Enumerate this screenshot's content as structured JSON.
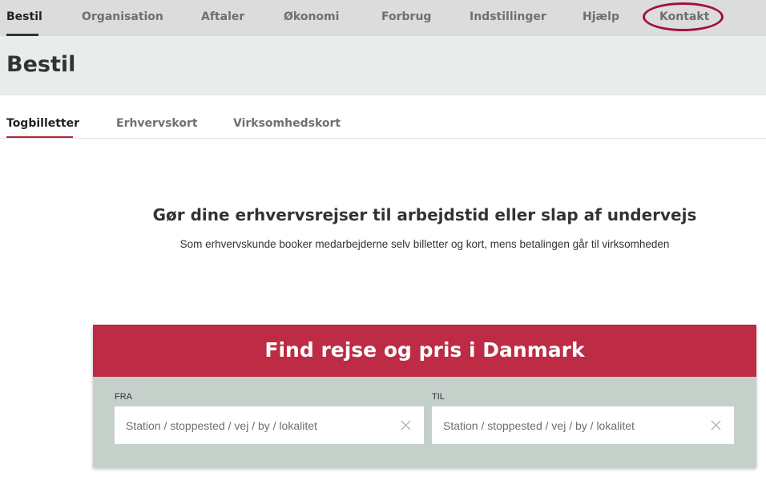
{
  "topnav": {
    "items": [
      {
        "label": "Bestil"
      },
      {
        "label": "Organisation"
      },
      {
        "label": "Aftaler"
      },
      {
        "label": "Økonomi"
      },
      {
        "label": "Forbrug"
      },
      {
        "label": "Indstillinger"
      },
      {
        "label": "Hjælp"
      },
      {
        "label": "Kontakt"
      }
    ],
    "active_index": 0
  },
  "page": {
    "title": "Bestil"
  },
  "subtabs": {
    "items": [
      {
        "label": "Togbilletter"
      },
      {
        "label": "Erhvervskort"
      },
      {
        "label": "Virksomhedskort"
      }
    ],
    "active_index": 0
  },
  "intro": {
    "heading": "Gør dine erhvervsrejser til arbejdstid eller slap af undervejs",
    "subtext": "Som erhvervskunde booker medarbejderne selv billetter og kort, mens betalingen går til virksomheden"
  },
  "search": {
    "title": "Find rejse og pris i Danmark",
    "from": {
      "label": "FRA",
      "placeholder": "Station / stoppested / vej / by / lokalitet",
      "value": ""
    },
    "to": {
      "label": "TIL",
      "placeholder": "Station / stoppested / vej / by / lokalitet",
      "value": ""
    }
  },
  "colors": {
    "nav_background": "#dcdcdc",
    "title_band_background": "#e8edec",
    "accent_red": "#bd2b44",
    "tab_underline": "#b4233c",
    "search_panel_background": "#c5d0ca",
    "annotation_circle": "#a50f3c"
  },
  "icons": {
    "clear": "close-icon"
  }
}
